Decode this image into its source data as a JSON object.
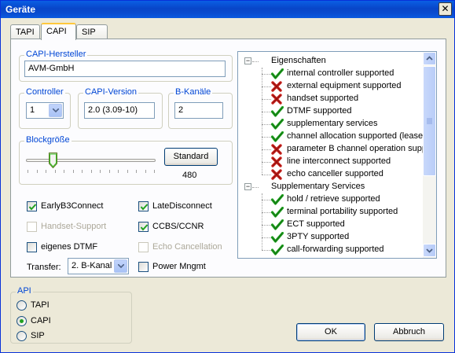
{
  "window": {
    "title": "Geräte"
  },
  "tabs": [
    {
      "label": "TAPI"
    },
    {
      "label": "CAPI"
    },
    {
      "label": "SIP"
    }
  ],
  "capi_hersteller": {
    "legend": "CAPI-Hersteller",
    "value": "AVM-GmbH"
  },
  "controller": {
    "legend": "Controller",
    "value": "1"
  },
  "capi_version": {
    "legend": "CAPI-Version",
    "value": "2.0 (3.09-10)"
  },
  "b_kanaele": {
    "legend": "B-Kanäle",
    "value": "2"
  },
  "blockgroesse": {
    "legend": "Blockgröße",
    "button": "Standard",
    "value": "480",
    "slider_fraction": 0.19
  },
  "options": {
    "early_b3_connect": {
      "label": "EarlyB3Connect",
      "checked": true
    },
    "late_disconnect": {
      "label": "LateDisconnect",
      "checked": true
    },
    "handset_support": {
      "label": "Handset-Support",
      "checked": false
    },
    "ccbs_ccnr": {
      "label": "CCBS/CCNR",
      "checked": true
    },
    "eigenes_dtmf": {
      "label": "eigenes DTMF",
      "checked": false
    },
    "echo_cancellation": {
      "label": "Echo Cancellation",
      "checked": false
    },
    "power_mngmt": {
      "label": "Power Mngmt",
      "checked": false
    }
  },
  "transfer": {
    "label": "Transfer:",
    "value": "2. B-Kanal"
  },
  "tree": {
    "groups": [
      {
        "label": "Eigenschaften",
        "items": [
          {
            "label": "internal controller supported",
            "status": "check"
          },
          {
            "label": "external equipment supported",
            "status": "cross"
          },
          {
            "label": "handset supported",
            "status": "cross"
          },
          {
            "label": "DTMF supported",
            "status": "check"
          },
          {
            "label": "supplementary services",
            "status": "check"
          },
          {
            "label": "channel allocation supported (lease",
            "status": "check"
          },
          {
            "label": "parameter B channel operation supp",
            "status": "cross"
          },
          {
            "label": "line interconnect supported",
            "status": "cross"
          },
          {
            "label": "echo canceller supported",
            "status": "cross"
          }
        ]
      },
      {
        "label": "Supplementary Services",
        "items": [
          {
            "label": "hold / retrieve supported",
            "status": "check"
          },
          {
            "label": "terminal portability supported",
            "status": "check"
          },
          {
            "label": "ECT supported",
            "status": "check"
          },
          {
            "label": "3PTY supported",
            "status": "check"
          },
          {
            "label": "call-forwarding supported",
            "status": "check"
          }
        ]
      }
    ]
  },
  "api": {
    "legend": "API",
    "options": [
      {
        "label": "TAPI",
        "selected": false
      },
      {
        "label": "CAPI",
        "selected": true
      },
      {
        "label": "SIP",
        "selected": false
      }
    ]
  },
  "buttons": {
    "ok": "OK",
    "cancel": "Abbruch"
  },
  "colors": {
    "title_bar": "#0a4ccf",
    "check": "#21a121",
    "cross": "#c8201c",
    "legend": "#0046d5"
  }
}
